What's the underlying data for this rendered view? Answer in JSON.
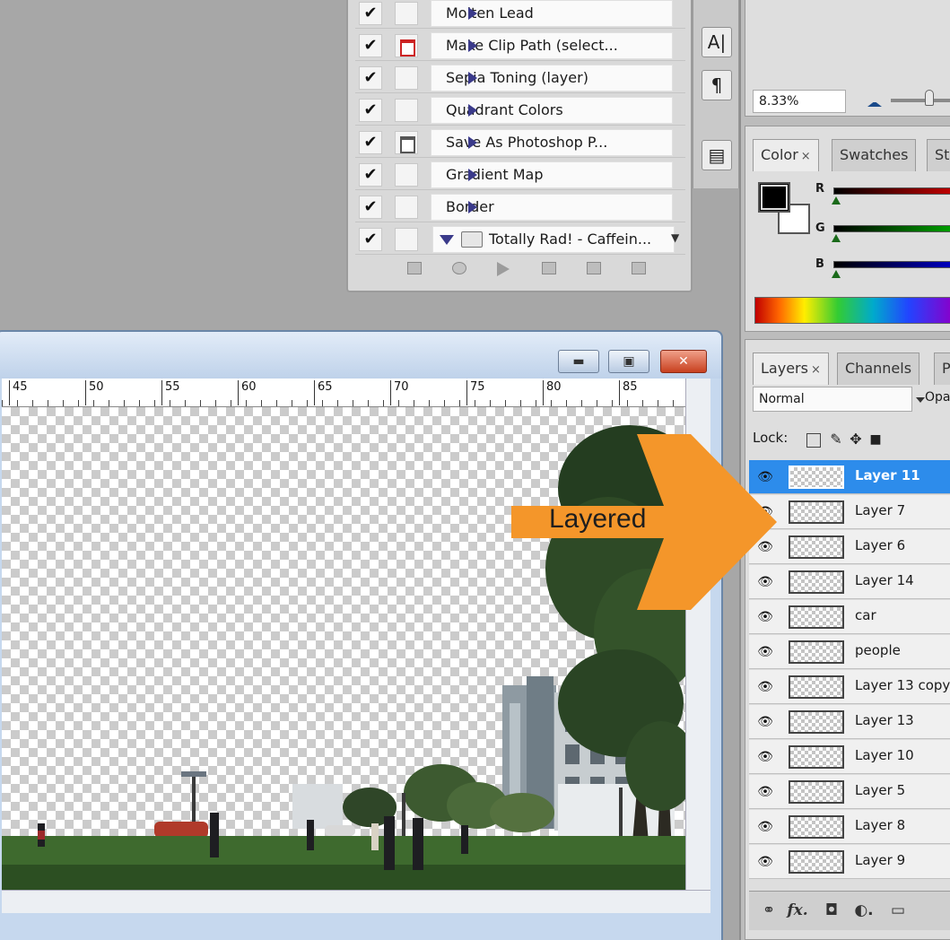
{
  "actions": {
    "items": [
      {
        "label": "Molten Lead",
        "dialog": "none"
      },
      {
        "label": "Make Clip Path (select...",
        "dialog": "red"
      },
      {
        "label": "Sepia Toning (layer)",
        "dialog": "none"
      },
      {
        "label": "Quadrant Colors",
        "dialog": "none"
      },
      {
        "label": "Save As Photoshop P...",
        "dialog": "gray"
      },
      {
        "label": "Gradient Map",
        "dialog": "none"
      },
      {
        "label": "Border",
        "dialog": "none"
      }
    ],
    "set_label": "Totally Rad! - Caffein...",
    "check_glyph": "✔",
    "toolbar_icons": [
      "stop-icon",
      "record-icon",
      "play-icon",
      "new-set-icon",
      "new-action-icon",
      "delete-icon"
    ]
  },
  "tool_strip": {
    "character_glyph": "A|",
    "paragraph_glyph": "¶",
    "panel_glyph": "▤"
  },
  "navigator": {
    "zoom": "8.33%"
  },
  "color_panel": {
    "tabs": [
      {
        "label": "Color",
        "close": "×"
      },
      {
        "label": "Swatches"
      },
      {
        "label": "St"
      }
    ],
    "sliders": [
      "R",
      "G",
      "B"
    ],
    "slider_colors": [
      "#c00000",
      "#00a000",
      "#0000c0"
    ]
  },
  "layers_panel": {
    "tabs": [
      {
        "label": "Layers",
        "close": "×"
      },
      {
        "label": "Channels"
      },
      {
        "label": "P"
      }
    ],
    "blend_mode": "Normal",
    "opacity_label": "Opa",
    "lock_label": "Lock:",
    "selected": "Layer 11",
    "layers": [
      "Layer 11",
      "Layer 7",
      "Layer 6",
      "Layer 14",
      "car",
      "people",
      "Layer 13 copy",
      "Layer 13",
      "Layer 10",
      "Layer 5",
      "Layer 8",
      "Layer 9"
    ],
    "eye_glyph": "👁",
    "footer_glyphs": {
      "link": "⚭",
      "fx": "fx.",
      "mask": "◘",
      "adjust": "◐.",
      "group": "▭"
    }
  },
  "document": {
    "ruler_labels": [
      "45",
      "50",
      "55",
      "60",
      "65",
      "70",
      "75",
      "80",
      "85"
    ],
    "window_buttons": {
      "minimize": "▬",
      "maximize": "▣",
      "close": "✕"
    }
  },
  "annotation": {
    "label": "Layered",
    "color": "#f4962a"
  }
}
